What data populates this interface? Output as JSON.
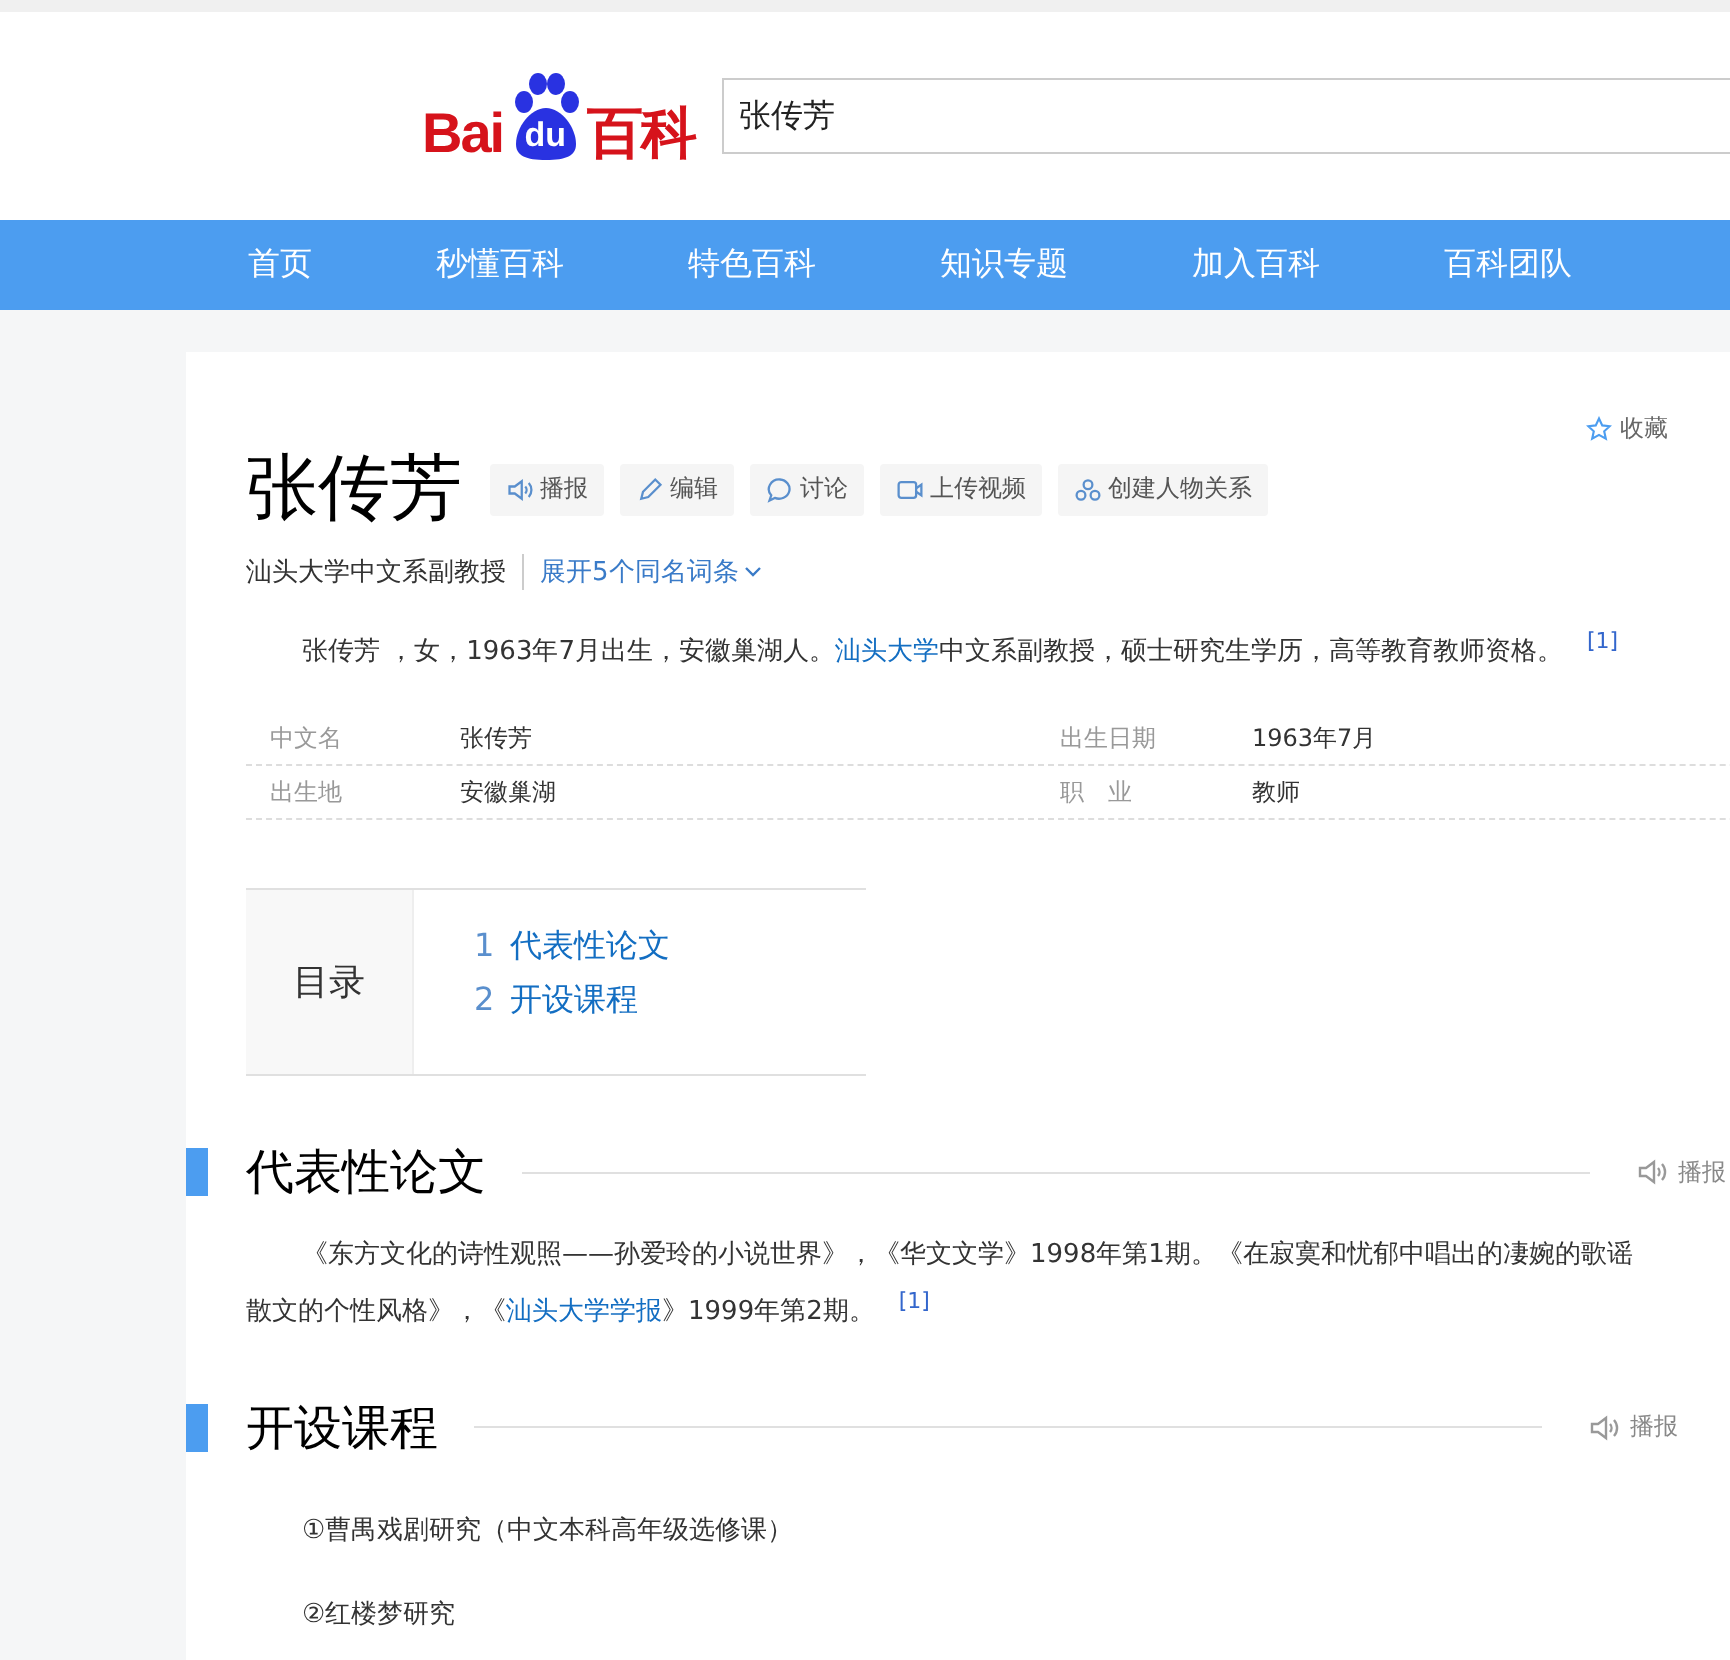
{
  "header": {
    "logo": {
      "latin_left": "Bai",
      "paw_text": "du",
      "cjk": "百科"
    },
    "search": {
      "value": "张传芳"
    }
  },
  "nav": [
    "首页",
    "秒懂百科",
    "特色百科",
    "知识专题",
    "加入百科",
    "百科团队"
  ],
  "entry": {
    "title": "张传芳",
    "actions": [
      {
        "kind": "speaker",
        "label": "播报"
      },
      {
        "kind": "pencil",
        "label": "编辑"
      },
      {
        "kind": "bubble",
        "label": "讨论"
      },
      {
        "kind": "video",
        "label": "上传视频"
      },
      {
        "kind": "people",
        "label": "创建人物关系"
      }
    ],
    "favorite": "收藏",
    "subtitle": "汕头大学中文系副教授",
    "expand": "展开5个同名词条",
    "summary": [
      {
        "text": "张传芳 ，女，1963年7月出生，安徽巢湖人。"
      },
      {
        "text": "汕头大学",
        "link": true
      },
      {
        "text": "中文系副教授，硕士研究生学历，高等教育教师资格。"
      }
    ],
    "summary_ref": "[1]",
    "info": [
      {
        "label": "中文名",
        "value": "张传芳",
        "label2": "出生日期",
        "value2": "1963年7月"
      },
      {
        "label": "出生地",
        "value": "安徽巢湖",
        "label2": "职　业",
        "value2": "教师"
      }
    ]
  },
  "toc": {
    "title": "目录",
    "items": [
      {
        "num": "1",
        "text": "代表性论文"
      },
      {
        "num": "2",
        "text": "开设课程"
      }
    ]
  },
  "sections": [
    {
      "title": "代表性论文",
      "speak": "播报",
      "kind": "paragraph",
      "lines": [
        [
          {
            "text": "《东方文化的诗性观照——孙爱玲的小说世界》，《华文文学》1998年第1期。《在寂寞和忧郁中唱出的凄婉的歌谣"
          }
        ],
        [
          {
            "text": "散文的个性风格》，《"
          },
          {
            "text": "汕头大学学报",
            "link": true
          },
          {
            "text": "》1999年第2期。"
          }
        ]
      ],
      "ref": "[1]"
    },
    {
      "title": "开设课程",
      "speak": "播报",
      "kind": "list",
      "items": [
        "①曹禺戏剧研究（中文本科高年级选修课）",
        "②红楼梦研究"
      ]
    }
  ]
}
